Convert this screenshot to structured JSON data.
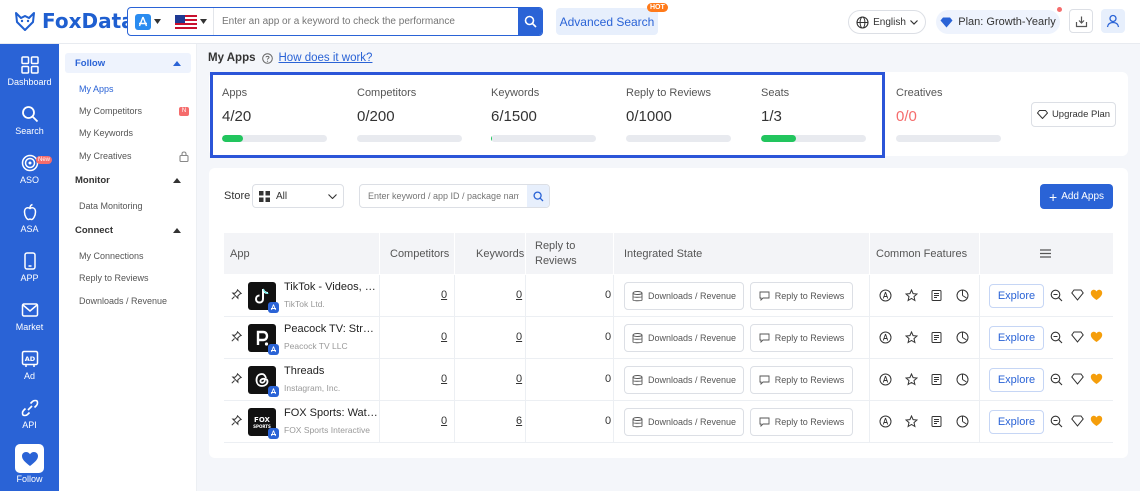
{
  "header": {
    "logo_text": "FoxData",
    "search_placeholder": "Enter an app or a keyword to check the performance",
    "advanced_search": "Advanced Search",
    "hot_badge": "HOT",
    "language": "English",
    "plan": "Plan: Growth-Yearly"
  },
  "sidenav": [
    {
      "label": "Dashboard",
      "icon": "grid-icon"
    },
    {
      "label": "Search",
      "icon": "search-icon"
    },
    {
      "label": "ASO",
      "icon": "target-icon",
      "badge": "New"
    },
    {
      "label": "ASA",
      "icon": "apple-icon"
    },
    {
      "label": "APP",
      "icon": "phone-icon"
    },
    {
      "label": "Market",
      "icon": "mail-icon"
    },
    {
      "label": "Ad",
      "icon": "ad-icon"
    },
    {
      "label": "API",
      "icon": "link-icon"
    },
    {
      "label": "Follow",
      "icon": "heart-icon"
    }
  ],
  "subnav": {
    "follow": "Follow",
    "my_apps": "My Apps",
    "my_competitors": "My Competitors",
    "competitors_badge": "N",
    "my_keywords": "My Keywords",
    "my_creatives": "My Creatives",
    "monitor": "Monitor",
    "data_monitoring": "Data Monitoring",
    "connect": "Connect",
    "my_connections": "My Connections",
    "reply_to_reviews": "Reply to Reviews",
    "downloads_revenue": "Downloads / Revenue"
  },
  "main": {
    "title": "My Apps",
    "how_link": "How does it work?"
  },
  "stats": [
    {
      "label": "Apps",
      "value": "4/20",
      "fill": 0.2
    },
    {
      "label": "Competitors",
      "value": "0/200",
      "fill": 0
    },
    {
      "label": "Keywords",
      "value": "6/1500",
      "fill": 0.004
    },
    {
      "label": "Reply to Reviews",
      "value": "0/1000",
      "fill": 0
    },
    {
      "label": "Seats",
      "value": "1/3",
      "fill": 0.333
    },
    {
      "label": "Creatives",
      "value": "0/0",
      "fill": 0
    }
  ],
  "upgrade_plan": "Upgrade Plan",
  "toolbar": {
    "store_label": "Store",
    "store_value": "All",
    "keyword_placeholder": "Enter keyword / app ID / package name",
    "add_apps": "Add Apps"
  },
  "table": {
    "headers": {
      "app": "App",
      "competitors": "Competitors",
      "keywords": "Keywords",
      "reply_line1": "Reply to",
      "reply_line2": "Reviews",
      "integrated": "Integrated State",
      "features": "Common Features"
    },
    "downloads_btn": "Downloads / Revenue",
    "reply_btn": "Reply to Reviews",
    "explore": "Explore",
    "rows": [
      {
        "name": "TikTok - Videos, Shop & LIVE",
        "developer": "TikTok Ltd.",
        "competitors": "0",
        "keywords": "0",
        "reply": "0",
        "icon": "tiktok-icon"
      },
      {
        "name": "Peacock TV: Stream TV & Movies",
        "developer": "Peacock TV LLC",
        "competitors": "0",
        "keywords": "0",
        "reply": "0",
        "icon": "peacock-icon"
      },
      {
        "name": "Threads",
        "developer": "Instagram, Inc.",
        "competitors": "0",
        "keywords": "0",
        "reply": "0",
        "icon": "threads-icon"
      },
      {
        "name": "FOX Sports: Watch Live",
        "developer": "FOX Sports Interactive",
        "competitors": "0",
        "keywords": "6",
        "reply": "0",
        "icon": "foxsports-icon"
      }
    ]
  },
  "colors": {
    "primary": "#2a63d6",
    "success": "#22c55e",
    "danger": "#f56c6c",
    "hot": "#ff7a1a",
    "heart": "#f59e0b"
  }
}
